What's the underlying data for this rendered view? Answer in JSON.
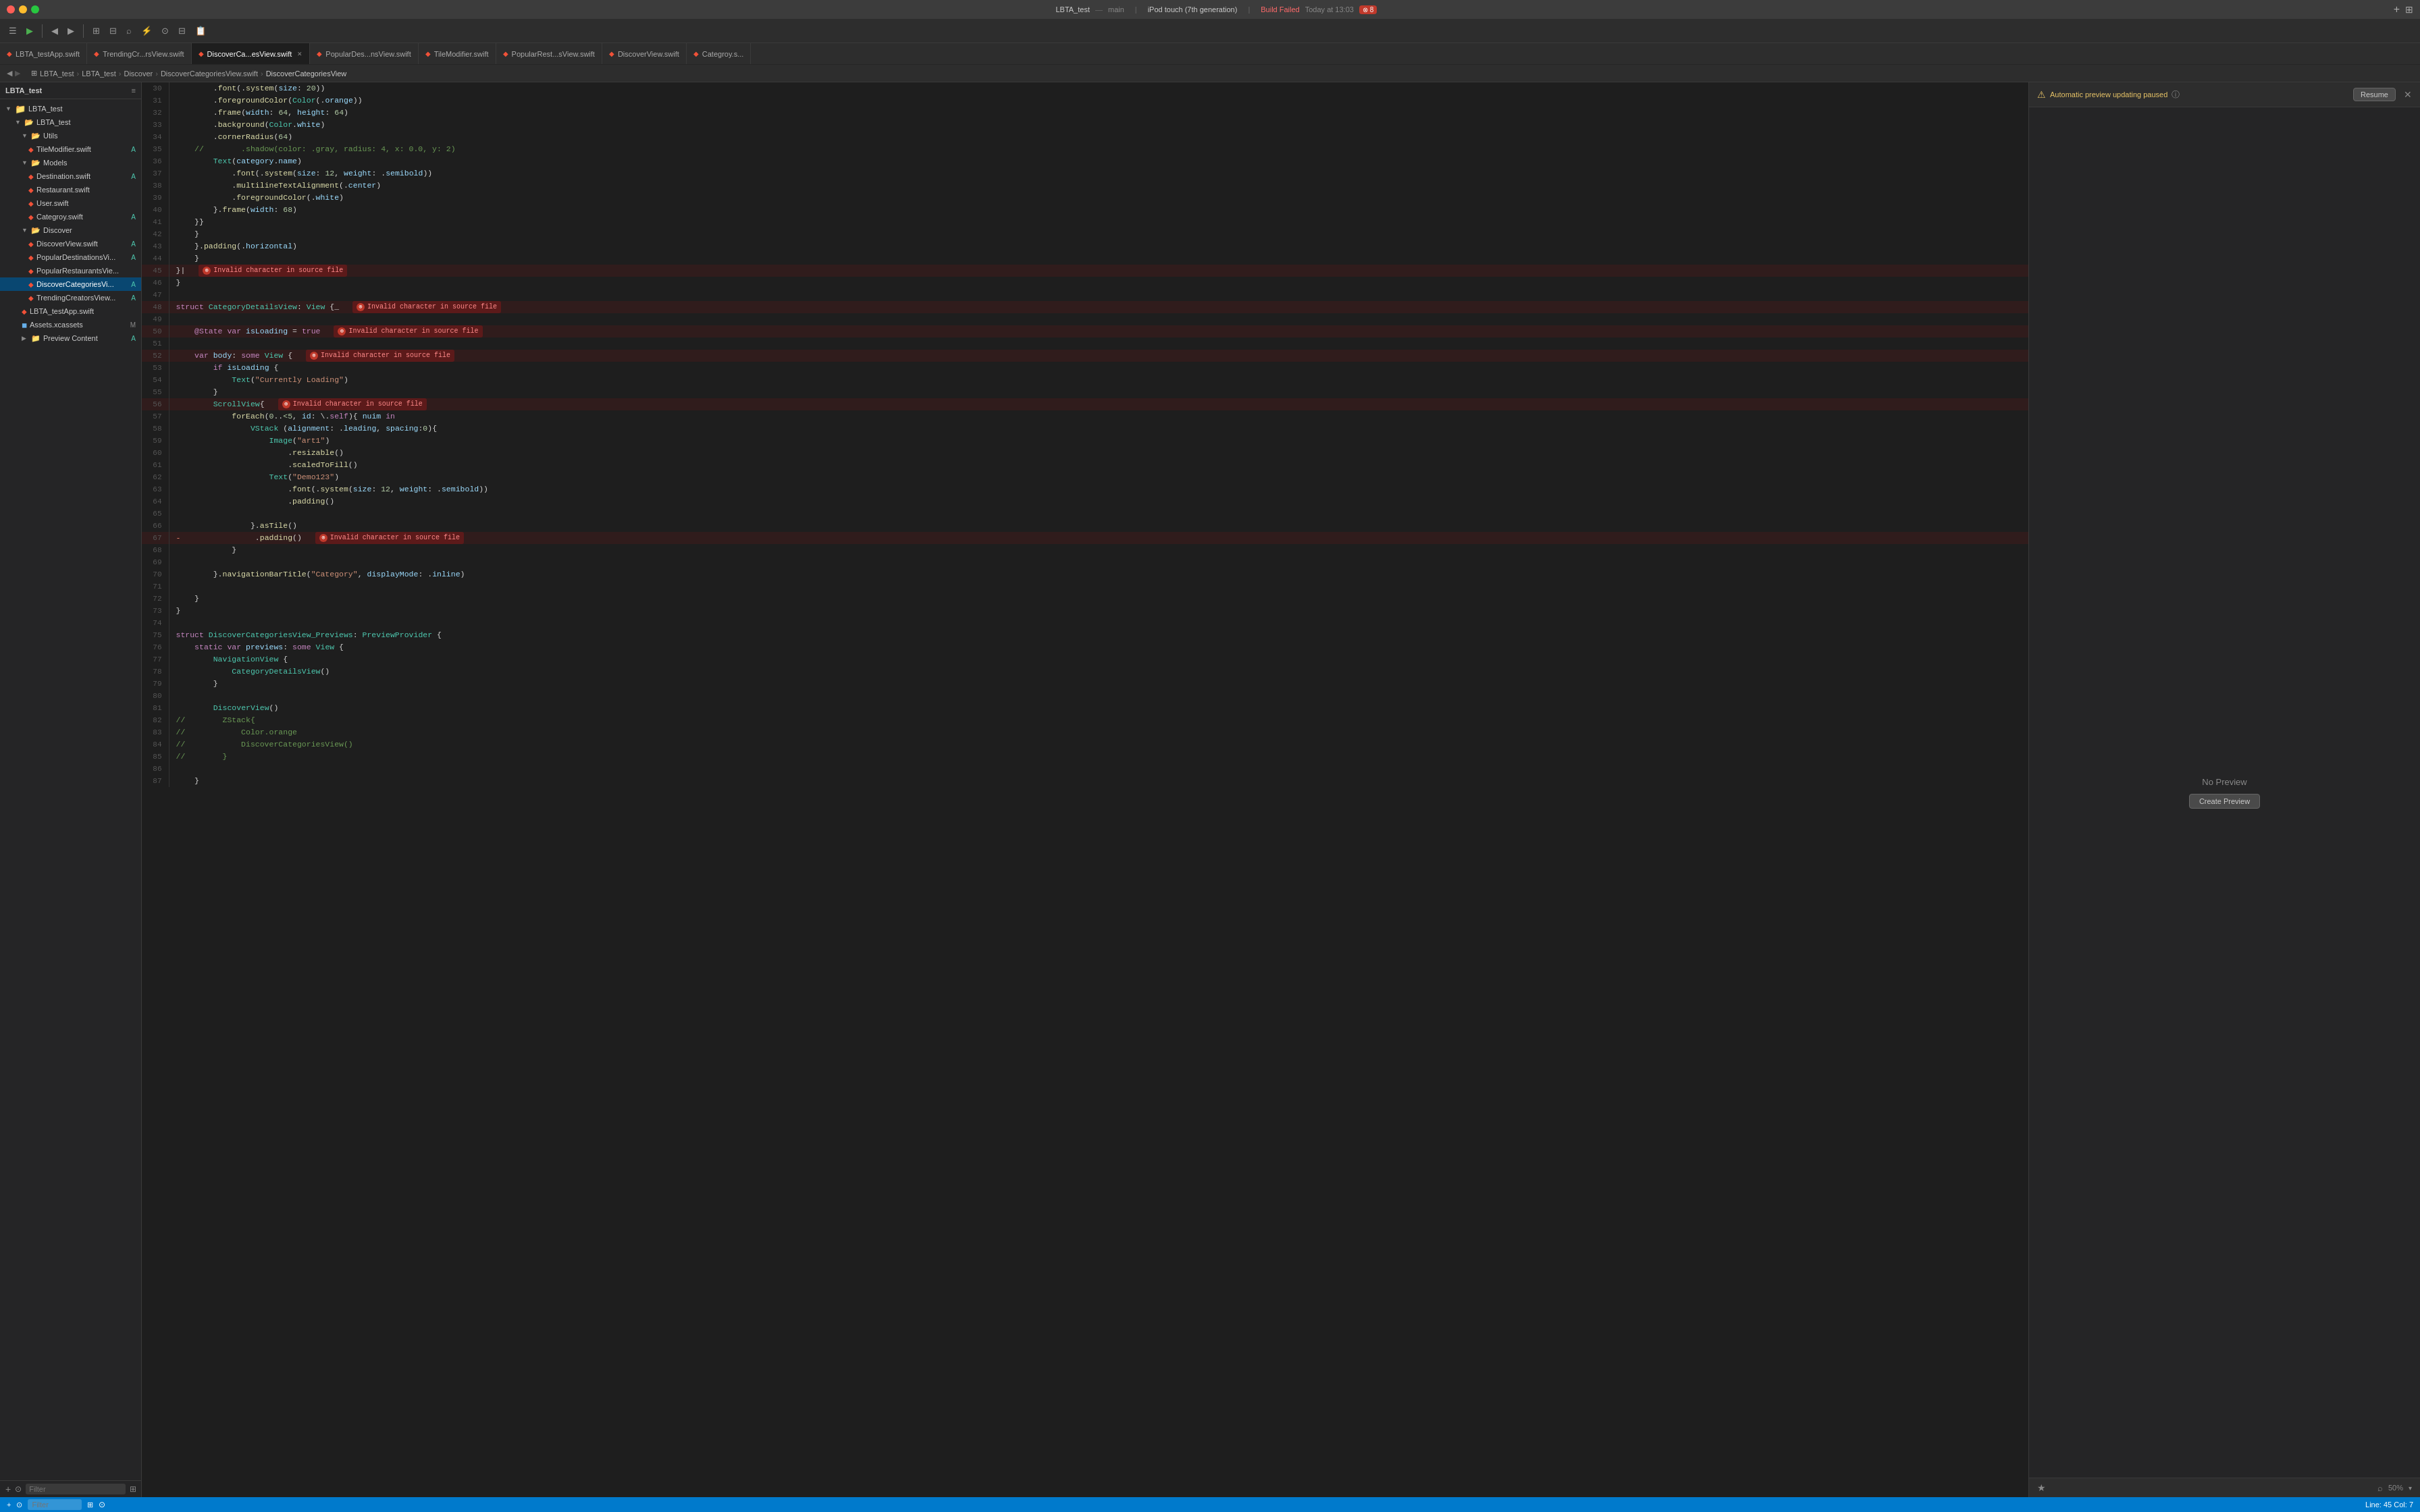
{
  "titleBar": {
    "appName": "LBTA_test",
    "subtitle": "main",
    "deviceTarget": "iPod touch (7th generation)",
    "buildStatus": "Build Failed",
    "buildTime": "Today at 13:03",
    "errorCount": "8"
  },
  "toolbar": {
    "buttons": [
      "◀",
      "▶",
      "◀▶",
      "☰",
      "⊞",
      "⊟",
      "⌕",
      "◈",
      "⧖",
      "⊟",
      "☰"
    ]
  },
  "tabs": [
    {
      "label": "LBTA_testApp.swift",
      "type": "swift",
      "active": false
    },
    {
      "label": "TrendingCr...rsView.swift",
      "type": "swift",
      "active": false
    },
    {
      "label": "DiscoverCa...esView.swift",
      "type": "swift",
      "active": true
    },
    {
      "label": "PopularDes...nsView.swift",
      "type": "swift",
      "active": false
    },
    {
      "label": "TileModifier.swift",
      "type": "swift",
      "active": false
    },
    {
      "label": "PopularRest...sView.swift",
      "type": "swift",
      "active": false
    },
    {
      "label": "DiscoverView.swift",
      "type": "swift",
      "active": false
    },
    {
      "label": "Categroy.s...",
      "type": "swift",
      "active": false
    }
  ],
  "breadcrumb": {
    "parts": [
      "LBTA_test",
      "LBTA_test",
      "Discover",
      "DiscoverCategoriesView.swift",
      "DiscoverCategoriesView"
    ]
  },
  "sidebar": {
    "projectName": "LBTA_test",
    "filterPlaceholder": "Filter",
    "items": [
      {
        "label": "LBTA_test",
        "indent": 0,
        "type": "project",
        "expanded": true,
        "badge": ""
      },
      {
        "label": "LBTA_test",
        "indent": 1,
        "type": "folder",
        "expanded": true,
        "badge": ""
      },
      {
        "label": "Utils",
        "indent": 2,
        "type": "folder",
        "expanded": true,
        "badge": ""
      },
      {
        "label": "TileModifier.swift",
        "indent": 3,
        "type": "swift",
        "badge": "A"
      },
      {
        "label": "Models",
        "indent": 2,
        "type": "folder",
        "expanded": true,
        "badge": ""
      },
      {
        "label": "Destination.swift",
        "indent": 3,
        "type": "swift",
        "badge": "A"
      },
      {
        "label": "Restaurant.swift",
        "indent": 3,
        "type": "swift",
        "badge": ""
      },
      {
        "label": "User.swift",
        "indent": 3,
        "type": "swift",
        "badge": ""
      },
      {
        "label": "Categroy.swift",
        "indent": 3,
        "type": "swift",
        "badge": "A"
      },
      {
        "label": "Discover",
        "indent": 2,
        "type": "folder",
        "expanded": true,
        "badge": ""
      },
      {
        "label": "DiscoverView.swift",
        "indent": 3,
        "type": "swift",
        "badge": "A"
      },
      {
        "label": "PopularDestinationsVi...",
        "indent": 3,
        "type": "swift",
        "badge": "A"
      },
      {
        "label": "PopularRestaurantsVie...",
        "indent": 3,
        "type": "swift",
        "badge": ""
      },
      {
        "label": "DiscoverCategoriesVi...",
        "indent": 3,
        "type": "swift",
        "badge": "A",
        "active": true
      },
      {
        "label": "TrendingCreatorsView...",
        "indent": 3,
        "type": "swift",
        "badge": "A"
      },
      {
        "label": "LBTA_testApp.swift",
        "indent": 2,
        "type": "swift",
        "badge": ""
      },
      {
        "label": "Assets.xcassets",
        "indent": 2,
        "type": "assets",
        "badge": "M"
      },
      {
        "label": "Preview Content",
        "indent": 2,
        "type": "folder",
        "expanded": false,
        "badge": "A"
      }
    ]
  },
  "codeLines": [
    {
      "num": 30,
      "text": "        .font(.system(size: 20))",
      "error": false
    },
    {
      "num": 31,
      "text": "        .foregroundColor(Color(.orange))",
      "error": false
    },
    {
      "num": 32,
      "text": "        .frame(width: 64, height: 64)",
      "error": false
    },
    {
      "num": 33,
      "text": "        .background(Color.white)",
      "error": false
    },
    {
      "num": 34,
      "text": "        .cornerRadius(64)",
      "error": false
    },
    {
      "num": 35,
      "text": "    //        .shadow(color: .gray, radius: 4, x: 0.0, y: 2)",
      "error": false
    },
    {
      "num": 36,
      "text": "        Text(category.name)",
      "error": false
    },
    {
      "num": 37,
      "text": "            .font(.system(size: 12, weight: .semibold))",
      "error": false
    },
    {
      "num": 38,
      "text": "            .multilineTextAlignment(.center)",
      "error": false
    },
    {
      "num": 39,
      "text": "            .foregroundColor(.white)",
      "error": false
    },
    {
      "num": 40,
      "text": "        }.frame(width: 68)",
      "error": false
    },
    {
      "num": 41,
      "text": "    }}",
      "error": false
    },
    {
      "num": 42,
      "text": "    }",
      "error": false
    },
    {
      "num": 43,
      "text": "    }.padding(.horizontal)",
      "error": false
    },
    {
      "num": 44,
      "text": "    }",
      "error": false
    },
    {
      "num": 45,
      "text": "}|",
      "error": true,
      "errorMsg": "Invalid character in source file"
    },
    {
      "num": 46,
      "text": "}",
      "error": false
    },
    {
      "num": 47,
      "text": "",
      "error": false
    },
    {
      "num": 48,
      "text": "struct CategoryDetailsView: View {_",
      "error": true,
      "errorMsg": "Invalid character in source file"
    },
    {
      "num": 49,
      "text": "",
      "error": false
    },
    {
      "num": 50,
      "text": "    @State var isLoading = true",
      "error": true,
      "errorMsg": "Invalid character in source file"
    },
    {
      "num": 51,
      "text": "",
      "error": false
    },
    {
      "num": 52,
      "text": "    var body: some View {",
      "error": true,
      "errorMsg": "Invalid character in source file"
    },
    {
      "num": 53,
      "text": "        if isLoading {",
      "error": false
    },
    {
      "num": 54,
      "text": "            Text(\"Currently Loading\")",
      "error": false
    },
    {
      "num": 55,
      "text": "        }",
      "error": false
    },
    {
      "num": 56,
      "text": "        ScrollView{",
      "error": true,
      "errorMsg": "Invalid character in source file"
    },
    {
      "num": 57,
      "text": "            forEach(0..<5, id: \\.self){ nuim in",
      "error": false
    },
    {
      "num": 58,
      "text": "                VStack (alignment: .leading, spacing:0){",
      "error": false
    },
    {
      "num": 59,
      "text": "                    Image(\"art1\")",
      "error": false
    },
    {
      "num": 60,
      "text": "                        .resizable()",
      "error": false
    },
    {
      "num": 61,
      "text": "                        .scaledToFill()",
      "error": false
    },
    {
      "num": 62,
      "text": "                    Text(\"Demo123\")",
      "error": false
    },
    {
      "num": 63,
      "text": "                        .font(.system(size: 12, weight: .semibold))",
      "error": false
    },
    {
      "num": 64,
      "text": "                        .padding()",
      "error": false
    },
    {
      "num": 65,
      "text": "",
      "error": false
    },
    {
      "num": 66,
      "text": "                }.asTile()",
      "error": false
    },
    {
      "num": 67,
      "text": "-                .padding()",
      "error": true,
      "errorMsg": "Invalid character in source file"
    },
    {
      "num": 68,
      "text": "            }",
      "error": false
    },
    {
      "num": 69,
      "text": "",
      "error": false
    },
    {
      "num": 70,
      "text": "        }.navigationBarTitle(\"Category\", displayMode: .inline)",
      "error": false
    },
    {
      "num": 71,
      "text": "",
      "error": false
    },
    {
      "num": 72,
      "text": "    }",
      "error": false
    },
    {
      "num": 73,
      "text": "}",
      "error": false
    },
    {
      "num": 74,
      "text": "",
      "error": false
    },
    {
      "num": 75,
      "text": "struct DiscoverCategoriesView_Previews: PreviewProvider {",
      "error": false
    },
    {
      "num": 76,
      "text": "    static var previews: some View {",
      "error": false
    },
    {
      "num": 77,
      "text": "        NavigationView {",
      "error": false
    },
    {
      "num": 78,
      "text": "            CategoryDetailsView()",
      "error": false
    },
    {
      "num": 79,
      "text": "        }",
      "error": false
    },
    {
      "num": 80,
      "text": "",
      "error": false
    },
    {
      "num": 81,
      "text": "        DiscoverView()",
      "error": false
    },
    {
      "num": 82,
      "text": "//        ZStack{",
      "error": false
    },
    {
      "num": 83,
      "text": "//            Color.orange",
      "error": false
    },
    {
      "num": 84,
      "text": "//            DiscoverCategoriesView()",
      "error": false
    },
    {
      "num": 85,
      "text": "//        }",
      "error": false
    },
    {
      "num": 86,
      "text": "",
      "error": false
    },
    {
      "num": 87,
      "text": "    }",
      "error": false
    }
  ],
  "preview": {
    "warningText": "Automatic preview updating paused",
    "resumeLabel": "Resume",
    "noPreviewText": "No Preview",
    "createPreviewLabel": "Create Preview"
  },
  "statusBar": {
    "addTabLabel": "+",
    "filterLabel": "Filter",
    "lineInfo": "Line: 45  Col: 7",
    "zoomLevel": "50%"
  }
}
